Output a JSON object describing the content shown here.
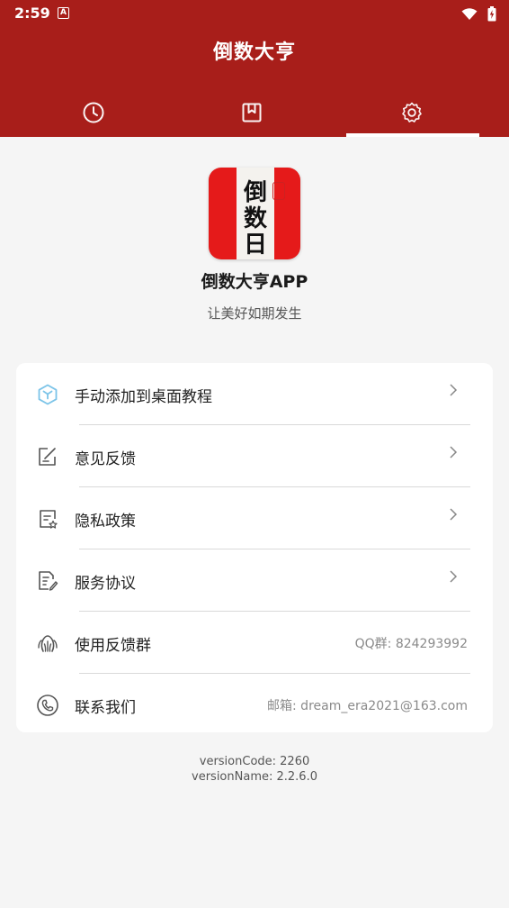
{
  "status": {
    "time": "2:59",
    "notif_letter": "A"
  },
  "app": {
    "title": "倒数大亨"
  },
  "tabs": [
    {
      "name": "countdown",
      "icon": "clock-icon"
    },
    {
      "name": "bookmark",
      "icon": "bookmark-icon"
    },
    {
      "name": "settings",
      "icon": "gear-icon",
      "active": true
    }
  ],
  "logo": {
    "chars": [
      "倒",
      "数",
      "日"
    ]
  },
  "about": {
    "name": "倒数大亨APP",
    "slogan": "让美好如期发生"
  },
  "menu": [
    {
      "label": "手动添加到桌面教程",
      "icon": "cube-icon",
      "chevron": true
    },
    {
      "label": "意见反馈",
      "icon": "feedback-edit-icon",
      "chevron": true
    },
    {
      "label": "隐私政策",
      "icon": "privacy-doc-icon",
      "chevron": true
    },
    {
      "label": "服务协议",
      "icon": "agreement-doc-icon",
      "chevron": true
    },
    {
      "label": "使用反馈群",
      "icon": "group-users-icon",
      "value": "QQ群: 824293992"
    },
    {
      "label": "联系我们",
      "icon": "phone-icon",
      "value": "邮箱: dream_era2021@163.com"
    }
  ],
  "version": {
    "code": "versionCode: 2260",
    "name": "versionName: 2.2.6.0"
  },
  "colors": {
    "primary": "#a81e1a",
    "logo_red": "#e51a1a",
    "icon_accent": "#7cc4e8"
  }
}
